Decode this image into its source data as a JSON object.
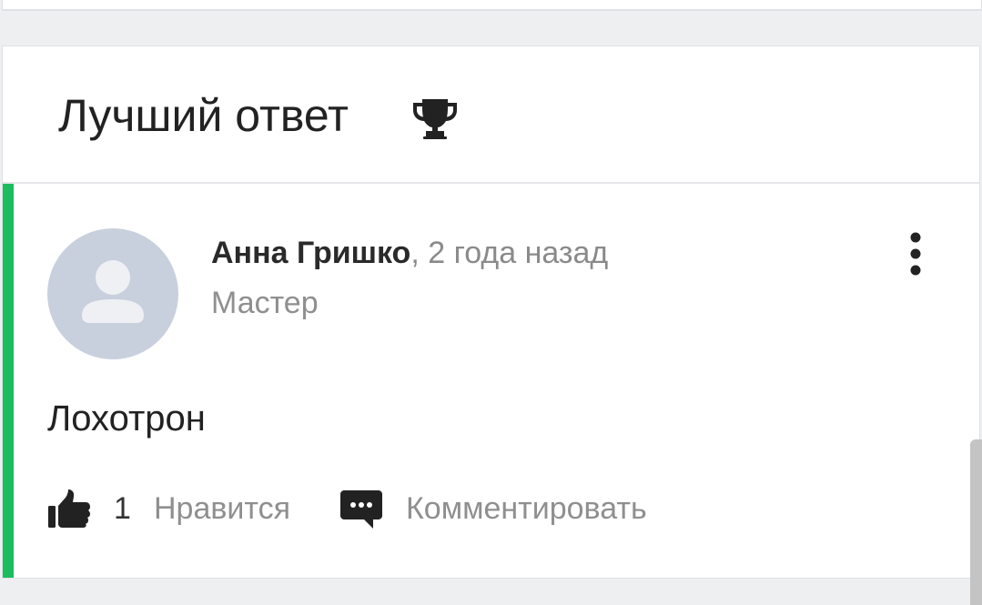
{
  "best_answer": {
    "title": "Лучший ответ",
    "title_icon": "trophy-icon",
    "accent_color": "#1cbd5f"
  },
  "answer": {
    "author": {
      "name": "Анна Гришко",
      "separator": ", ",
      "time": "2 года назад",
      "rank": "Мастер",
      "avatar_icon": "user-avatar-placeholder"
    },
    "menu_icon": "more-vertical-icon",
    "text": "Лохотрон",
    "actions": {
      "like_icon": "thumbs-up-icon",
      "like_count": "1",
      "like_label": "Нравится",
      "comment_icon": "comment-icon",
      "comment_label": "Комментировать"
    }
  }
}
